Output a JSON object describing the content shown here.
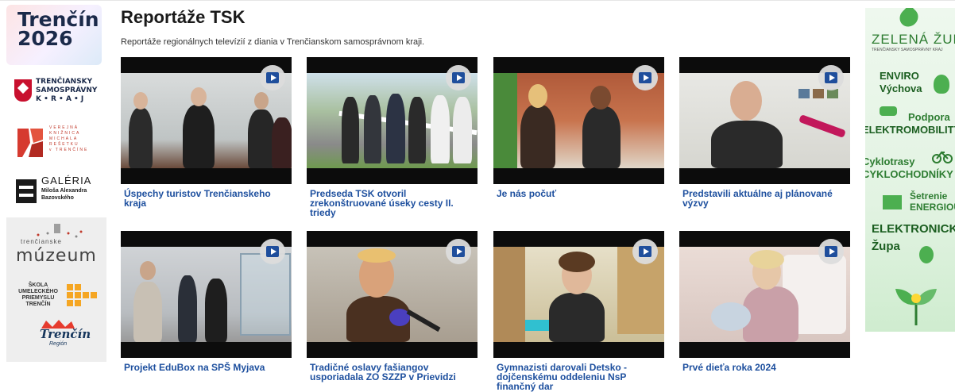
{
  "sidebar": {
    "logo_2026": {
      "line1": "Trenčín",
      "line2": "2026"
    },
    "kraj": {
      "line1": "TRENČIANSKY",
      "line2": "SAMOSPRÁVNY",
      "line3": "K • R • A • J"
    },
    "kniznica": {
      "line1": "VEREJNÁ",
      "line2": "KNIŽNICA",
      "line3": "MICHALA",
      "line4": "REŠETKU",
      "line5": "v TRENČÍNE"
    },
    "galeria": {
      "line1": "GALÉRIA",
      "line2": "Miloša Alexandra",
      "line3": "Bazovského"
    },
    "muzeum": {
      "small": "trenčianske",
      "big": "múzeum"
    },
    "skola": {
      "line1": "ŠKOLA",
      "line2": "UMELECKÉHO",
      "line3": "PRIEMYSLU",
      "line4": "TRENČÍN"
    },
    "trencin_region": {
      "main": "Trenčín",
      "sub": "Región"
    }
  },
  "main": {
    "title": "Reportáže TSK",
    "description": "Reportáže regionálnych televízií z diania v Trenčianskom samosprávnom kraji.",
    "videos": [
      {
        "caption": "Úspechy turistov Trenčianskeho kraja"
      },
      {
        "caption": "Predseda TSK otvoril zrekonštruované úseky cesty II. triedy"
      },
      {
        "caption": "Je nás počuť"
      },
      {
        "caption": "Predstavili aktuálne aj plánované výzvy"
      },
      {
        "caption": "Projekt EduBox na SPŠ Myjava"
      },
      {
        "caption": "Tradičné oslavy fašiangov usporiadala ZO SZZP v Prievidzi"
      },
      {
        "caption": "Gymnazisti darovali Detsko - dojčenskému oddeleniu NsP finančný dar"
      },
      {
        "caption": "Prvé dieťa roka 2024"
      }
    ]
  },
  "ad": {
    "title": "ZELENÁ ŽUPA",
    "subtitle": "TRENČIANSKY SAMOSPRÁVNY KRAJ",
    "enviro1": "ENVIRO",
    "enviro2": "Výchova",
    "podpora": "Podpora",
    "elektromobility": "ELEKTROMOBILITY",
    "cyklotrasy": "Cyklotrasy",
    "cyklochodniky": "CYKLOCHODNÍKY",
    "setrenie": "Šetrenie",
    "energiou": "ENERGIOU",
    "elektronicka": "ELEKTRONICKÁ",
    "zupa": "Župa"
  },
  "colors": {
    "caption": "#1d4f9e",
    "play_button": "#1f4e9c",
    "ad_green": "#2e7d32"
  }
}
